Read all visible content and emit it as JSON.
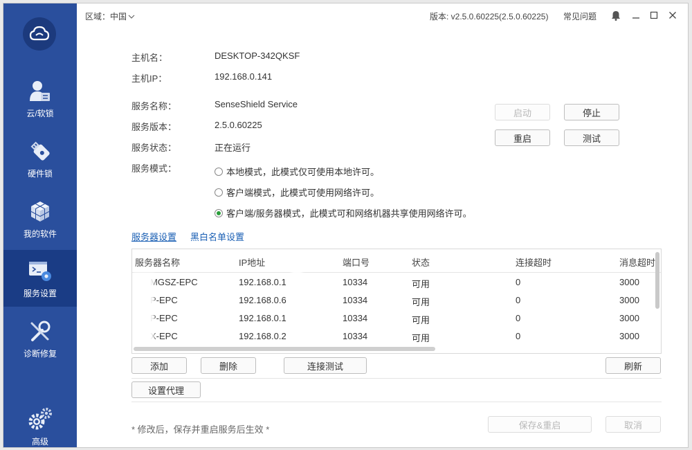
{
  "titlebar": {
    "region_label": "区域：中国",
    "version": "版本: v2.5.0.60225(2.5.0.60225)",
    "faq": "常见问题"
  },
  "sidebar": {
    "items": [
      {
        "label": "云/软锁"
      },
      {
        "label": "硬件锁"
      },
      {
        "label": "我的软件"
      },
      {
        "label": "服务设置"
      },
      {
        "label": "诊断修复"
      },
      {
        "label": "高级"
      }
    ]
  },
  "host": {
    "name_label": "主机名：",
    "name_value": "DESKTOP-342QKSF",
    "ip_label": "主机IP：",
    "ip_value": "192.168.0.141"
  },
  "service": {
    "name_label": "服务名称：",
    "name_value": "SenseShield Service",
    "version_label": "服务版本：",
    "version_value": "2.5.0.60225",
    "status_label": "服务状态：",
    "status_value": "正在运行",
    "mode_label": "服务模式：",
    "modes": [
      {
        "label": "本地模式，此模式仅可使用本地许可。"
      },
      {
        "label": "客户端模式，此模式可使用网络许可。"
      },
      {
        "label": "客户端/服务器模式，此模式可和网络机器共享使用网络许可。"
      }
    ]
  },
  "control_buttons": {
    "start": "启动",
    "stop": "停止",
    "restart": "重启",
    "test": "测试"
  },
  "tabs": {
    "server_settings": "服务器设置",
    "blacklist": "黑白名单设置"
  },
  "table": {
    "headers": [
      "服务器名称",
      "IP地址",
      "端口号",
      "状态",
      "连接超时",
      "消息超时"
    ],
    "rows": [
      [
        "MGSZ-EPC",
        "192.168.0.1",
        "10334",
        "可用",
        "0",
        "3000"
      ],
      [
        "P-EPC",
        "192.168.0.6",
        "10334",
        "可用",
        "0",
        "3000"
      ],
      [
        "P-EPC",
        "192.168.0.1",
        "10334",
        "可用",
        "0",
        "3000"
      ],
      [
        "X-EPC",
        "192.168.0.2",
        "10334",
        "可用",
        "0",
        "3000"
      ]
    ]
  },
  "table_buttons": {
    "add": "添加",
    "delete": "删除",
    "connect_test": "连接测试",
    "refresh": "刷新",
    "proxy": "设置代理"
  },
  "footer": {
    "note": "* 修改后，保存并重启服务后生效 *",
    "save_restart": "保存&重启",
    "cancel": "取消"
  }
}
